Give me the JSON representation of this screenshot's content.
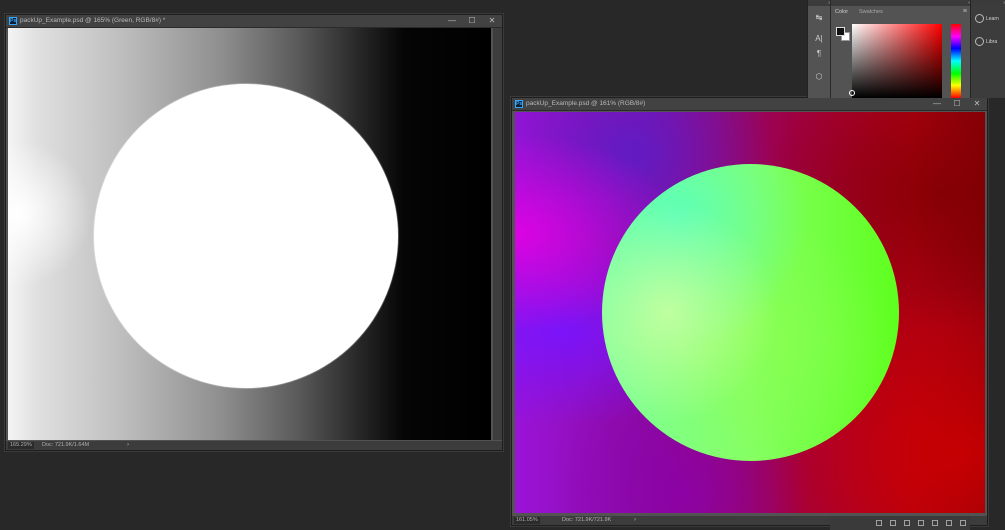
{
  "window_green": {
    "title": "packUp_Example.psd @ 165% (Green, RGB/8#) *",
    "zoom": "165.29%",
    "doc_info": "Doc: 721.9K/1.64M",
    "arrow": "›"
  },
  "window_rgb": {
    "title": "packUp_Example.psd @ 161% (RGB/8#)",
    "zoom": "161.05%",
    "doc_info": "Doc: 721.9K/721.9K",
    "arrow": "›"
  },
  "window_controls": {
    "minimize": "—",
    "maximize": "☐",
    "close": "✕"
  },
  "color_panel": {
    "tabs": [
      "Color",
      "Swatches"
    ],
    "menu": "≡",
    "collapse": "«",
    "foreground_color": "#111111",
    "background_color": "#ffffff",
    "field_hue": "#ff0000"
  },
  "tools": [
    {
      "icon": "transform-icon",
      "glyph": "↹"
    },
    {
      "icon": "type-tool-icon",
      "glyph": "A|"
    },
    {
      "icon": "paragraph-icon",
      "glyph": "¶"
    },
    {
      "icon": "3d-cube-icon",
      "glyph": "⬡"
    }
  ],
  "right_panel": {
    "collapse": "»",
    "items": [
      "Learn",
      "Libra"
    ]
  },
  "app_icon": "Ps"
}
